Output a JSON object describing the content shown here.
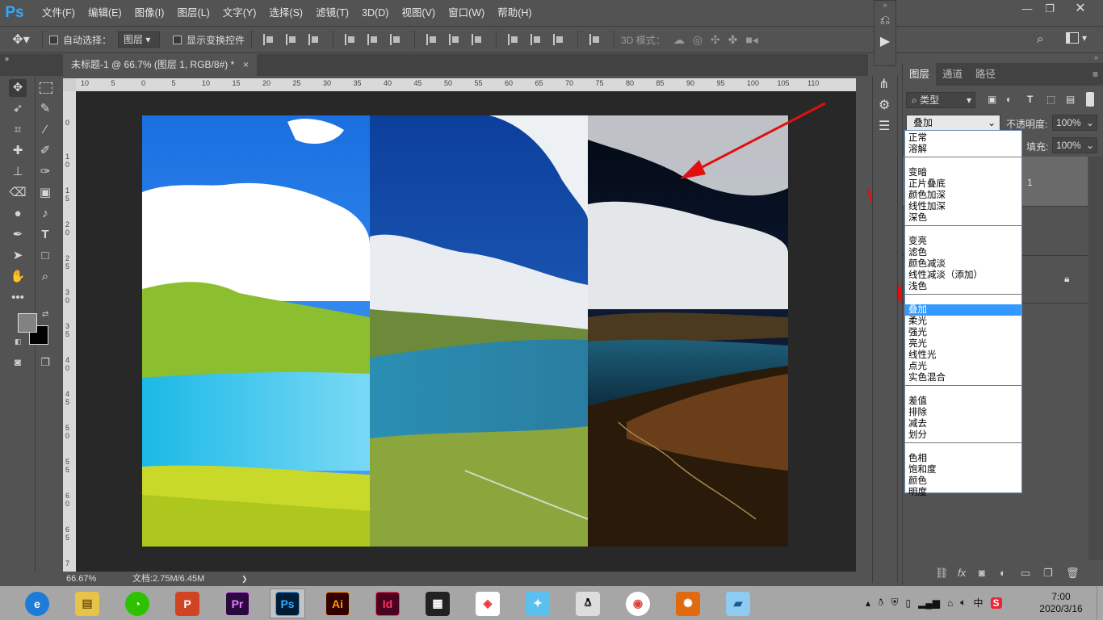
{
  "app": {
    "logo": "Ps"
  },
  "menu": [
    "文件(F)",
    "编辑(E)",
    "图像(I)",
    "图层(L)",
    "文字(Y)",
    "选择(S)",
    "滤镜(T)",
    "3D(D)",
    "视图(V)",
    "窗口(W)",
    "帮助(H)"
  ],
  "options": {
    "auto_select_label": "自动选择：",
    "auto_select_value": "图层",
    "show_transform_label": "显示变换控件",
    "mode3d_label": "3D 模式："
  },
  "document": {
    "tab_title": "未标题-1 @ 66.7% (图层 1, RGB/8#) *",
    "close_glyph": "×"
  },
  "ruler": {
    "top_ticks": [
      "10",
      "5",
      "0",
      "5",
      "10",
      "15",
      "20",
      "25",
      "30",
      "35",
      "40",
      "45",
      "50",
      "55",
      "60",
      "65",
      "70",
      "75",
      "80",
      "85",
      "90",
      "95",
      "100",
      "105",
      "110"
    ],
    "left_ticks": [
      "0",
      "1 0",
      "1 5",
      "2 0",
      "2 5",
      "3 0",
      "3 5",
      "4 0",
      "4 5",
      "5 0",
      "5 5",
      "6 0",
      "6 5",
      "7"
    ]
  },
  "status": {
    "zoom": "66.67%",
    "doc_info": "文档:2.75M/6.45M",
    "arrow": "❯"
  },
  "layers_panel": {
    "tabs": [
      "图层",
      "通道",
      "路径"
    ],
    "filter_label": "类型",
    "blend_mode": "叠加",
    "opacity_label": "不透明度:",
    "opacity_value": "100%",
    "fill_label": "填充:",
    "fill_value": "100%",
    "layer_number": "1"
  },
  "blend_groups": [
    [
      "正常",
      "溶解"
    ],
    [
      "变暗",
      "正片叠底",
      "颜色加深",
      "线性加深",
      "深色"
    ],
    [
      "变亮",
      "滤色",
      "颜色减淡",
      "线性减淡（添加）",
      "浅色"
    ],
    [
      "叠加",
      "柔光",
      "强光",
      "亮光",
      "线性光",
      "点光",
      "实色混合"
    ],
    [
      "差值",
      "排除",
      "减去",
      "划分"
    ],
    [
      "色相",
      "饱和度",
      "颜色",
      "明度"
    ]
  ],
  "selected_blend": "叠加",
  "taskbar": {
    "apps": [
      "ie",
      "explorer",
      "wechat",
      "powerpoint",
      "premiere",
      "photoshop",
      "illustrator",
      "indesign",
      "video-player",
      "app-colorful",
      "app-bird",
      "qq",
      "chrome",
      "fox-browser",
      "paint"
    ],
    "app_labels": {
      "powerpoint": "P",
      "premiere": "Pr",
      "photoshop": "Ps",
      "illustrator": "Ai",
      "indesign": "Id"
    },
    "tray_ime": "中",
    "clock_time": "7:00",
    "clock_date": "2020/3/16"
  },
  "colors": {
    "ui_bg": "#535353",
    "canvas_bg": "#282828",
    "ps_blue": "#31a8ff",
    "list_highlight": "#3399ff",
    "annotation_red": "#e01010"
  }
}
